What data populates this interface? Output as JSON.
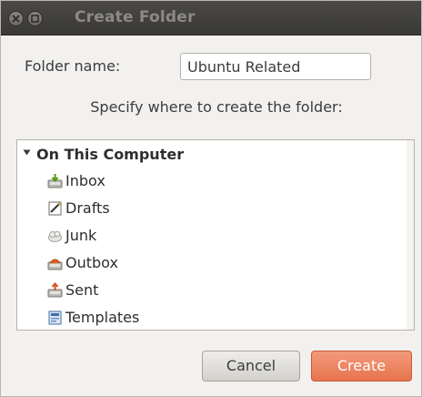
{
  "window": {
    "title": "Create Folder"
  },
  "form": {
    "folder_name_label": "Folder name:",
    "folder_name_value": "Ubuntu Related",
    "specify_text": "Specify where to create the folder:"
  },
  "tree": {
    "group_label": "On This Computer",
    "items": [
      {
        "label": "Inbox",
        "icon": "inbox-icon"
      },
      {
        "label": "Drafts",
        "icon": "drafts-icon"
      },
      {
        "label": "Junk",
        "icon": "junk-icon"
      },
      {
        "label": "Outbox",
        "icon": "outbox-icon"
      },
      {
        "label": "Sent",
        "icon": "sent-icon"
      },
      {
        "label": "Templates",
        "icon": "templates-icon"
      }
    ]
  },
  "buttons": {
    "cancel_label": "Cancel",
    "create_label": "Create"
  },
  "colors": {
    "accent_create": "#e7744e",
    "titlebar": "#3a3935"
  }
}
